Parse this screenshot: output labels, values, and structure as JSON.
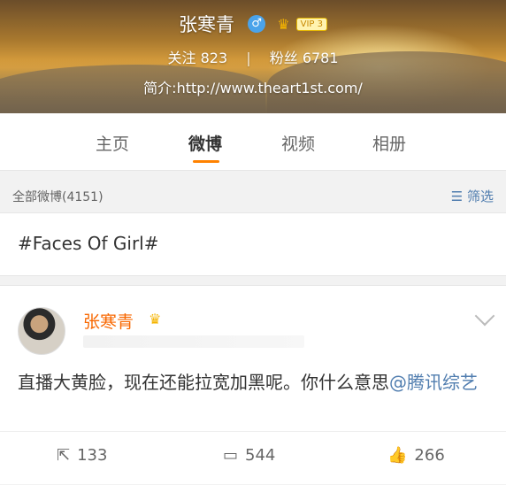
{
  "profile": {
    "name": "张寒青",
    "gender_icon": "male-icon",
    "vip_label": "VIP 3",
    "following_label": "关注",
    "following_count": "823",
    "followers_label": "粉丝",
    "followers_count": "6781",
    "intro": "简介:http://www.theart1st.com/"
  },
  "tabs": [
    {
      "label": "主页"
    },
    {
      "label": "微博",
      "active": true
    },
    {
      "label": "视频"
    },
    {
      "label": "相册"
    }
  ],
  "filter": {
    "all_label": "全部微博(4151)",
    "filter_label": "筛选",
    "filter_icon": "filter-icon"
  },
  "topic": "#Faces Of Girl#",
  "post": {
    "author": "张寒青",
    "text": "直播大黄脸，现在还能拉宽加黑呢。你什么意思",
    "mention": "@腾讯综艺",
    "repost_count": "133",
    "comment_count": "544",
    "like_count": "266"
  },
  "colors": {
    "accent": "#ff8200",
    "link": "#507daf",
    "author": "#f86700"
  }
}
